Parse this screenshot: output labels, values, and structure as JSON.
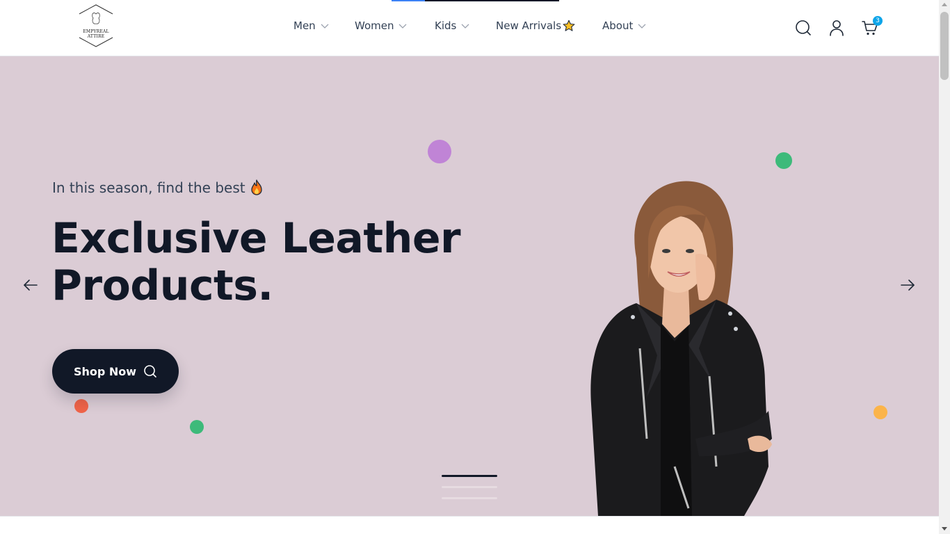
{
  "header": {
    "logo": {
      "text": "EMPYREAL ATTIRE",
      "icon": "leather-hide-icon"
    },
    "nav": [
      {
        "label": "Men",
        "has_dropdown": true
      },
      {
        "label": "Women",
        "has_dropdown": true
      },
      {
        "label": "Kids",
        "has_dropdown": true
      },
      {
        "label": "New Arrivals",
        "has_dropdown": false,
        "icon": "star-icon"
      },
      {
        "label": "About",
        "has_dropdown": true
      }
    ],
    "icons": [
      "search-icon",
      "user-icon",
      "cart-icon"
    ],
    "cart_count": "3"
  },
  "hero": {
    "subtitle": "In this season, find the best",
    "subtitle_icon": "fire-icon",
    "headline_line1": "Exclusive Leather",
    "headline_line2": "Products.",
    "cta_label": "Shop Now",
    "cta_icon": "search-icon",
    "slides_total": 3,
    "active_slide": 1,
    "prev_icon": "arrow-left-icon",
    "next_icon": "arrow-right-icon",
    "image": "woman-in-black-leather-jacket"
  },
  "colors": {
    "hero_bg": "#dbccd5",
    "dark": "#111827",
    "text": "#334155",
    "badge": "#0ea5e9",
    "dot_purple": "#c084d6",
    "dot_green": "#3dba7a",
    "dot_red": "#f06449",
    "dot_orange": "#fbb44a"
  }
}
